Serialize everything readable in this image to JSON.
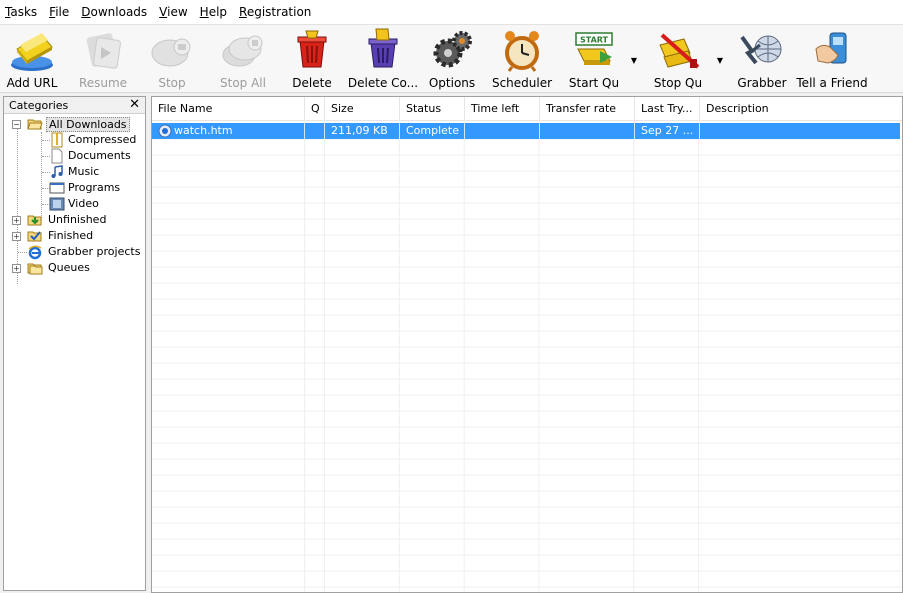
{
  "menu": [
    {
      "label": "Tasks",
      "ul": "T",
      "rest": "asks"
    },
    {
      "label": "File",
      "ul": "F",
      "rest": "ile"
    },
    {
      "label": "Downloads",
      "ul": "D",
      "rest": "ownloads"
    },
    {
      "label": "View",
      "ul": "V",
      "rest": "iew"
    },
    {
      "label": "Help",
      "ul": "H",
      "rest": "elp"
    },
    {
      "label": "Registration",
      "ul": "R",
      "rest": "egistration"
    }
  ],
  "toolbar": {
    "add_url": "Add URL",
    "resume": "Resume",
    "stop": "Stop",
    "stop_all": "Stop All",
    "delete": "Delete",
    "delete_completed": "Delete Co...",
    "options": "Options",
    "scheduler": "Scheduler",
    "start_queue": "Start Qu",
    "stop_queue": "Stop Qu",
    "grabber": "Grabber",
    "tell_friend": "Tell a Friend",
    "start_sign_text": "START"
  },
  "categories": {
    "title": "Categories",
    "close": "✕",
    "items": {
      "all_downloads": "All Downloads",
      "compressed": "Compressed",
      "documents": "Documents",
      "music": "Music",
      "programs": "Programs",
      "video": "Video",
      "unfinished": "Unfinished",
      "finished": "Finished",
      "grabber_projects": "Grabber projects",
      "queues": "Queues"
    }
  },
  "list": {
    "columns": {
      "file_name": "File Name",
      "q": "Q",
      "size": "Size",
      "status": "Status",
      "time_left": "Time left",
      "transfer_rate": "Transfer rate",
      "last_try": "Last Try...",
      "description": "Description"
    },
    "rows": [
      {
        "file_name": "watch.htm",
        "q": "",
        "size": "211,09  KB",
        "status": "Complete",
        "time_left": "",
        "transfer_rate": "",
        "last_try": "Sep 27 ...",
        "description": ""
      }
    ]
  },
  "colors": {
    "selection": "#3399ff",
    "toolbar_bg": "#f7f7f7",
    "disabled_text": "#9c9c9c"
  }
}
